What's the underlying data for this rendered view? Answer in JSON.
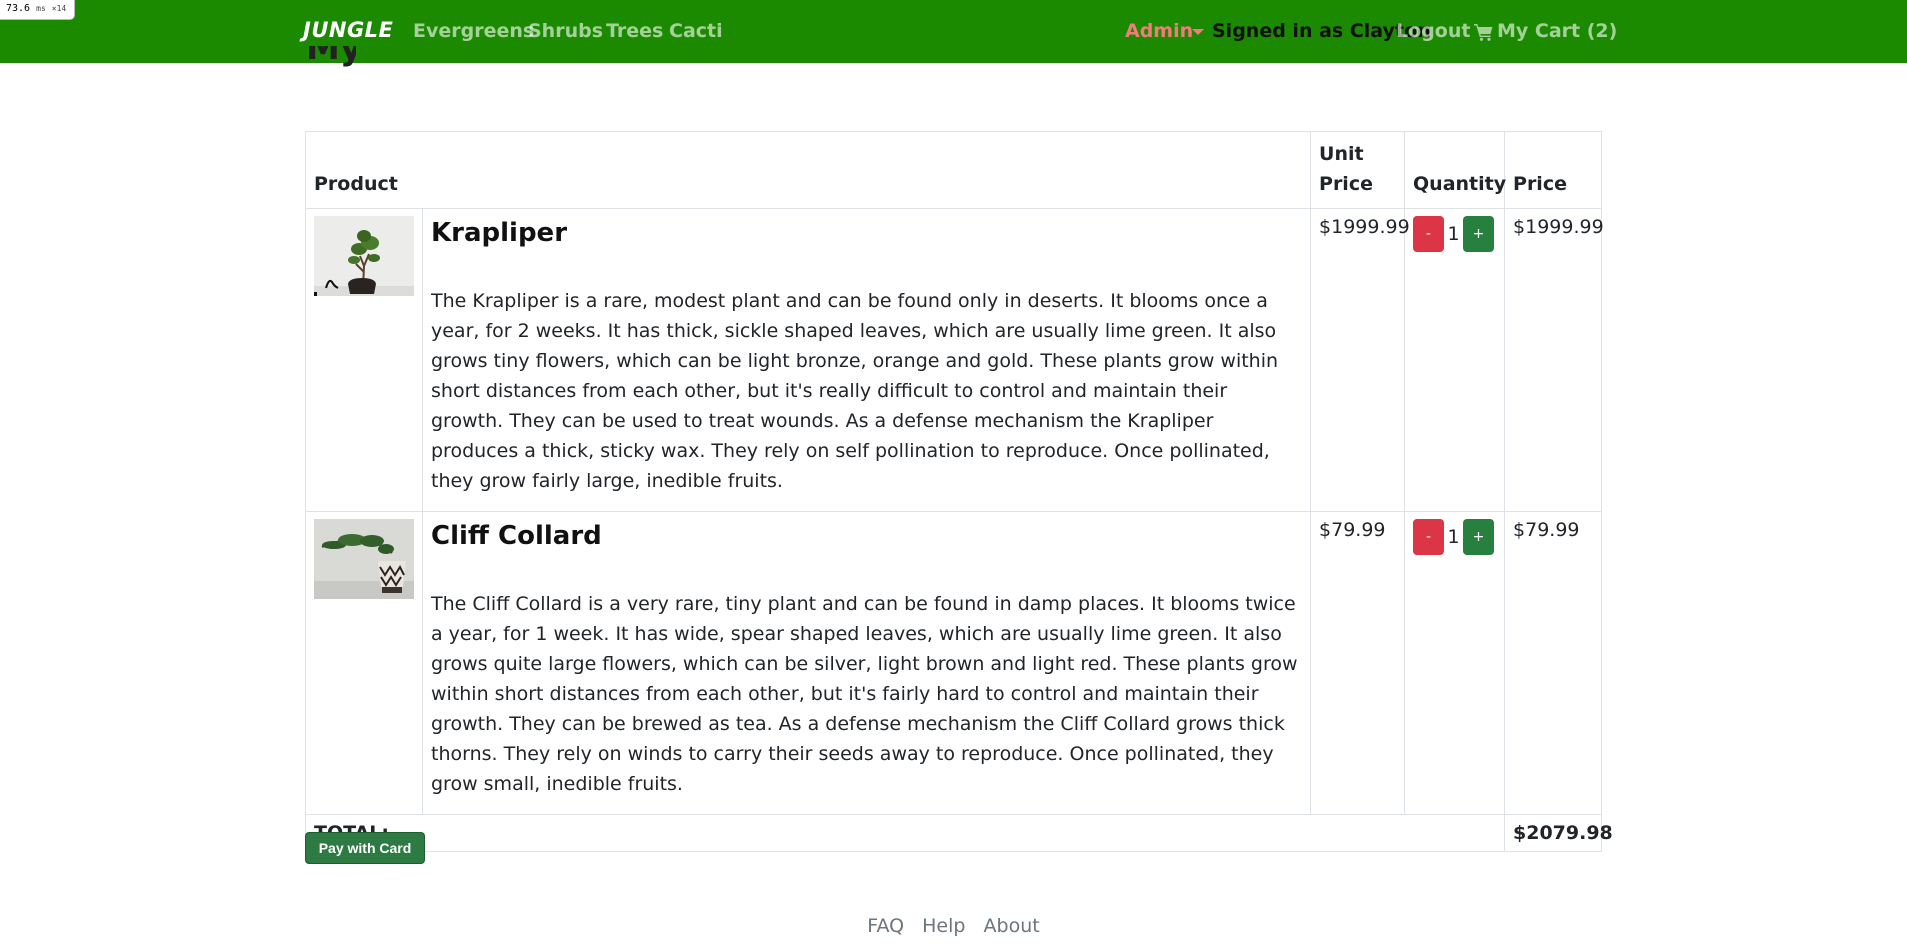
{
  "perf_overlay": {
    "time": "73.6",
    "unit": "ms",
    "mult": "×14"
  },
  "navbar": {
    "brand": "JUNGLE",
    "links": [
      "Evergreens",
      "Shrubs",
      "Trees",
      "Cacti"
    ],
    "admin_label": "Admin",
    "signed_in": "Signed in as Clayton",
    "logout": "Logout",
    "cart_label": "My Cart (2)",
    "bg_color": "#1c8a00"
  },
  "page_title_partial": "My",
  "table": {
    "headers": {
      "product": "Product",
      "unit_price": "Unit Price",
      "quantity": "Quantity",
      "price": "Price"
    },
    "items": [
      {
        "name": "Krapliper",
        "description": "The Krapliper is a rare, modest plant and can be found only in deserts. It blooms once a year, for 2 weeks. It has thick, sickle shaped leaves, which are usually lime green. It also grows tiny flowers, which can be light bronze, orange and gold. These plants grow within short distances from each other, but it's really difficult to control and maintain their growth. They can be used to treat wounds. As a defense mechanism the Krapliper produces a thick, sticky wax. They rely on self pollination to reproduce. Once pollinated, they grow fairly large, inedible fruits.",
        "unit_price": "$1999.99",
        "quantity": "1",
        "price": "$1999.99",
        "image_icon": "bonsai-plant-photo"
      },
      {
        "name": "Cliff Collard",
        "description": "The Cliff Collard is a very rare, tiny plant and can be found in damp places. It blooms twice a year, for 1 week. It has wide, spear shaped leaves, which are usually lime green. It also grows quite large flowers, which can be silver, light brown and light red. These plants grow within short distances from each other, but it's fairly hard to control and maintain their growth. They can be brewed as tea. As a defense mechanism the Cliff Collard grows thick thorns. They rely on winds to carry their seeds away to reproduce. Once pollinated, they grow small, inedible fruits.",
        "unit_price": "$79.99",
        "quantity": "1",
        "price": "$79.99",
        "image_icon": "cascade-bonsai-photo"
      }
    ],
    "minus_label": "-",
    "plus_label": "+",
    "total_label": "TOTAL:",
    "total_value": "$2079.98"
  },
  "pay_button": "Pay with Card",
  "footer": {
    "links": [
      "FAQ",
      "Help",
      "About"
    ]
  }
}
